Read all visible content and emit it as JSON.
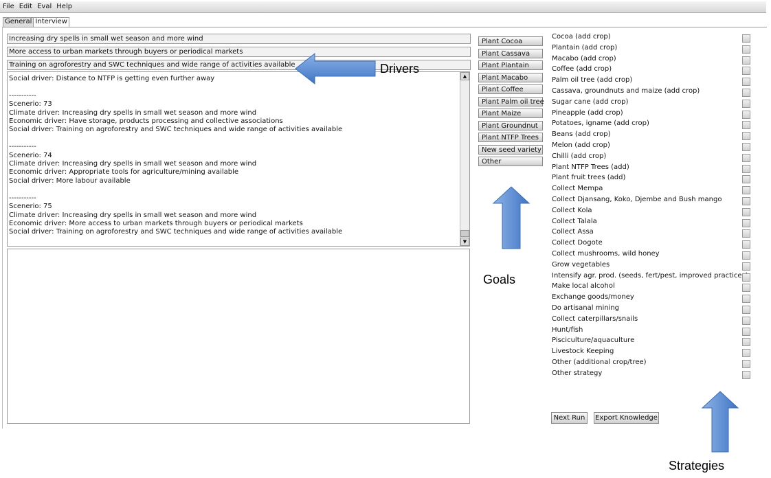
{
  "menu": [
    "File",
    "Edit",
    "Eval",
    "Help"
  ],
  "tabs": [
    {
      "label": "General"
    },
    {
      "label": "Interview"
    }
  ],
  "drivers": [
    "Increasing dry spells in small wet season and more wind",
    "More access to urban markets through buyers or periodical markets",
    "Training on agroforestry and SWC techniques and wide range of activities available"
  ],
  "log": "Social driver: Distance to NTFP is getting even further away\n\n-----------\nScenerio: 73\nClimate driver: Increasing dry spells in small wet season and more wind\nEconomic driver: Have storage, products processing and collective associations\nSocial driver: Training on agroforestry and SWC techniques and wide range of activities available\n\n-----------\nScenerio: 74\nClimate driver: Increasing dry spells in small wet season and more wind\nEconomic driver: Appropriate tools for agriculture/mining available\nSocial driver: More labour available\n\n-----------\nScenerio: 75\nClimate driver: Increasing dry spells in small wet season and more wind\nEconomic driver: More access to urban markets through buyers or periodical markets\nSocial driver: Training on agroforestry and SWC techniques and wide range of activities available",
  "goals": [
    "Plant Cocoa",
    "Plant Cassava",
    "Plant Plantain",
    "Plant Macabo",
    "Plant Coffee",
    "Plant Palm oil tree",
    "Plant Maize",
    "Plant Groundnut",
    "Plant NTFP Trees",
    "New seed variety",
    "Other"
  ],
  "strategies": [
    "Cocoa (add crop)",
    "Plantain (add crop)",
    "Macabo (add crop)",
    "Coffee (add crop)",
    "Palm oil tree (add crop)",
    "Cassava, groundnuts and maize (add crop)",
    "Sugar cane (add crop)",
    "Pineapple (add crop)",
    "Potatoes, igname (add crop)",
    "Beans (add crop)",
    "Melon (add crop)",
    "Chilli (add crop)",
    "Plant NTFP Trees (add)",
    "Plant fruit trees (add)",
    "Collect Mempa",
    "Collect Djansang, Koko, Djembe and Bush mango",
    "Collect Kola",
    "Collect Talala",
    "Collect Assa",
    "Collect Dogote",
    "Collect mushrooms, wild honey",
    "Grow vegetables",
    "Intensify agr. prod. (seeds, fert/pest, improved practices)",
    "Make local alcohol",
    "Exchange goods/money",
    "Do artisanal mining",
    "Collect caterpillars/snails",
    "Hunt/fish",
    "Pisciculture/aquaculture",
    "Livestock Keeping",
    "Other (additional crop/tree)",
    "Other strategy"
  ],
  "buttons": {
    "next_run": "Next Run",
    "export": "Export Knowledge"
  },
  "annotations": {
    "drivers": "Drivers",
    "goals": "Goals",
    "strategies": "Strategies",
    "arrow_color": "#5b8fd6"
  }
}
